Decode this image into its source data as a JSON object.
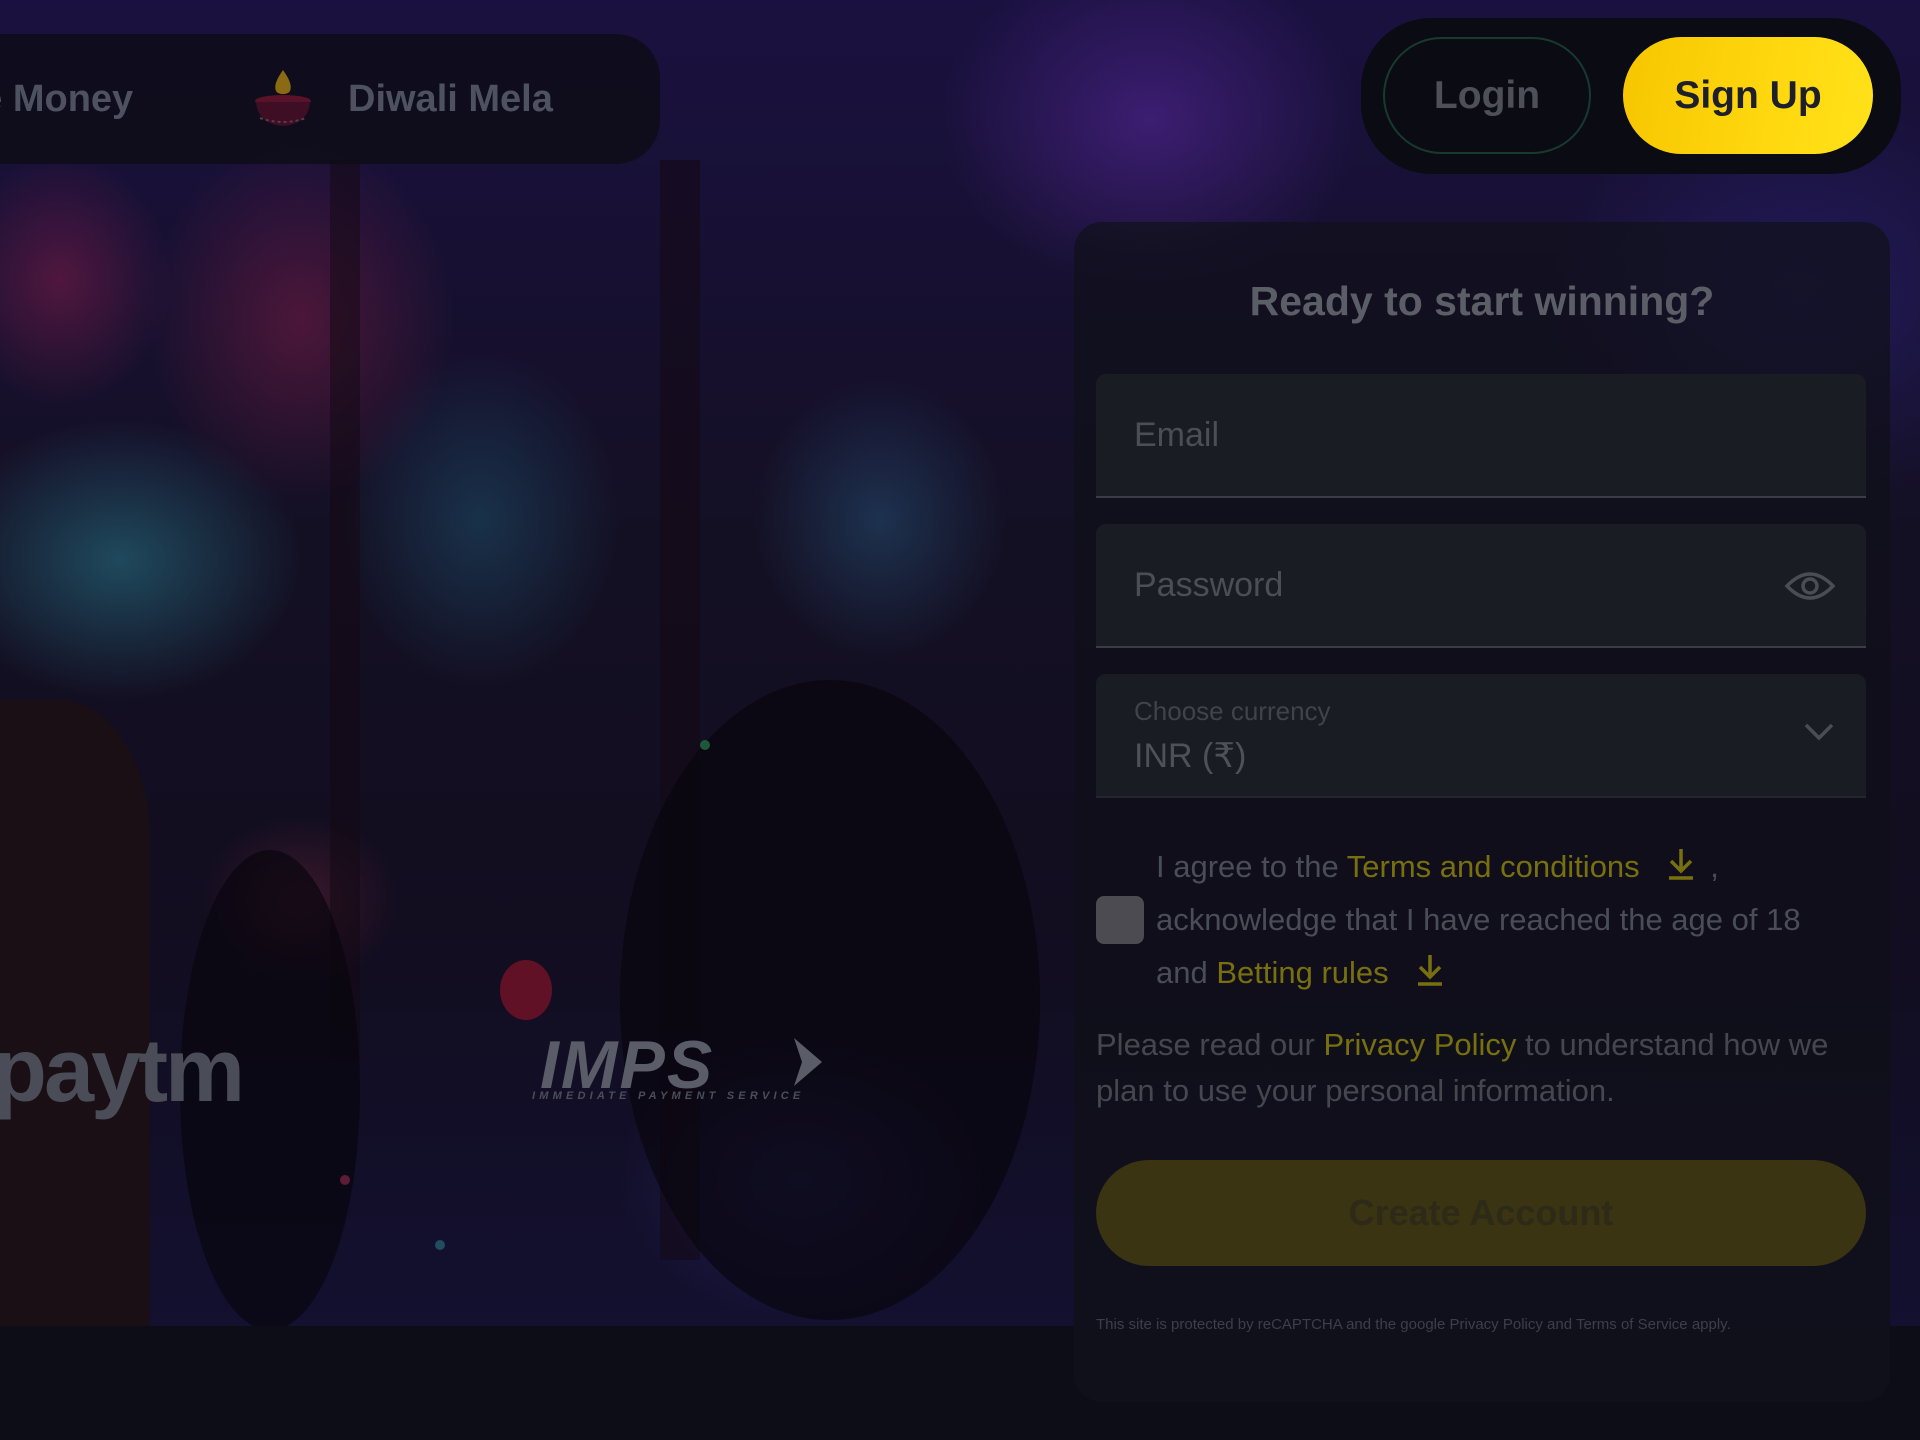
{
  "nav": {
    "promos": [
      {
        "label": "ee Money",
        "icon": "money-icon"
      },
      {
        "label": "Diwali Mela",
        "icon": "diya-lamp-icon"
      }
    ],
    "login_label": "Login",
    "signup_label": "Sign Up"
  },
  "payments": {
    "paytm": "paytm",
    "imps": "IMPS",
    "imps_sub": "IMMEDIATE PAYMENT SERVICE"
  },
  "signup_form": {
    "title": "Ready to start winning?",
    "email_placeholder": "Email",
    "password_placeholder": "Password",
    "password_toggle_icon": "eye-icon",
    "currency_label": "Choose currency",
    "currency_value": "INR (₹)",
    "consent": {
      "checked": false,
      "part1": "I agree to the ",
      "terms_link": "Terms and conditions",
      "part2": " ,",
      "part3": "acknowledge that I have reached the age of 18 and ",
      "rules_link": "Betting rules"
    },
    "privacy": {
      "part1": "Please read our ",
      "link": "Privacy Policy",
      "part2": " to understand how we plan to use your personal information."
    },
    "create_label": "Create Account",
    "recaptcha": "This site is protected by reCAPTCHA and the google Privacy Policy and Terms of Service apply."
  },
  "colors": {
    "accent_yellow": "#ffd80f",
    "link_yellow": "#78700e",
    "background": "#0c0d16"
  }
}
